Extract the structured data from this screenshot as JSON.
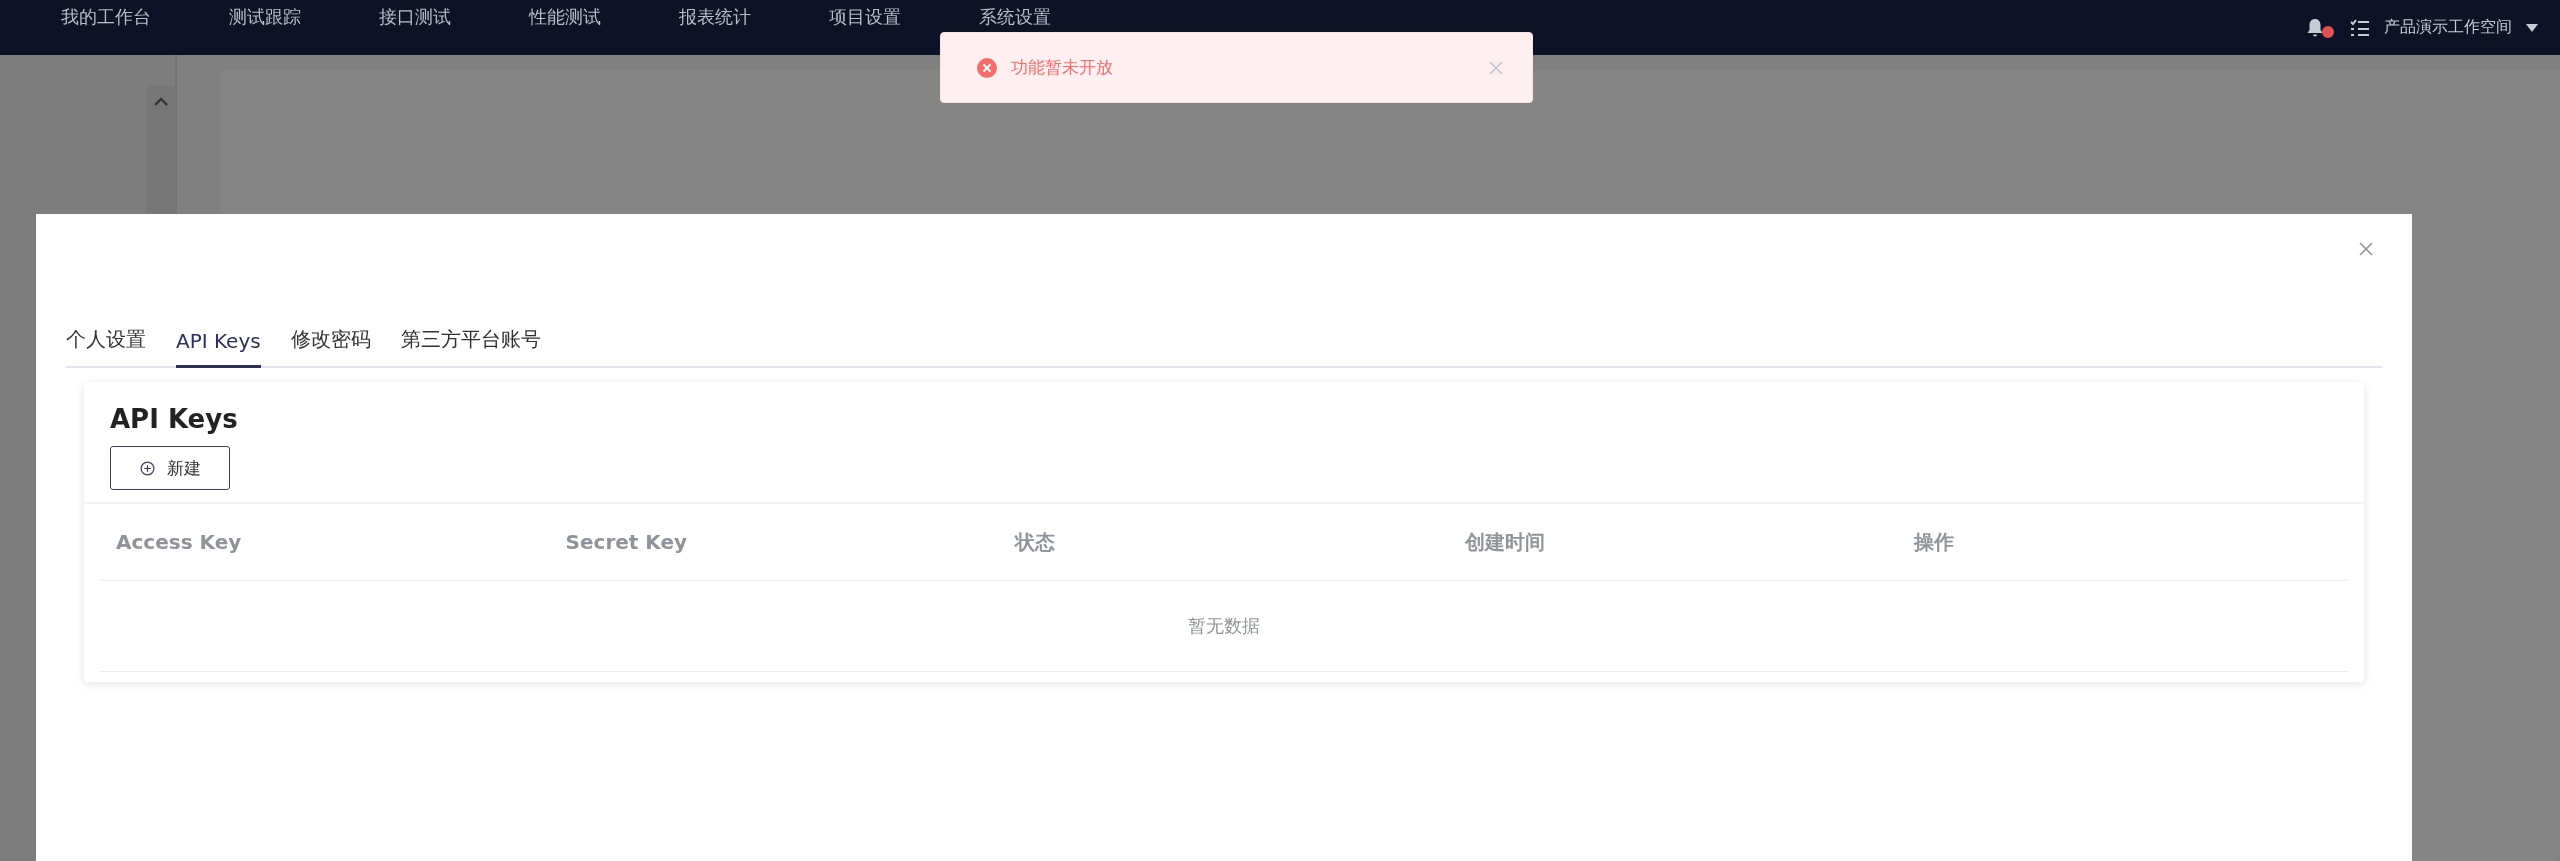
{
  "nav": {
    "items": [
      {
        "label": "我的工作台"
      },
      {
        "label": "测试跟踪"
      },
      {
        "label": "接口测试"
      },
      {
        "label": "性能测试"
      },
      {
        "label": "报表统计"
      },
      {
        "label": "项目设置"
      },
      {
        "label": "系统设置"
      }
    ],
    "workspace": "产品演示工作空间",
    "has_unread": true
  },
  "toast": {
    "kind": "error",
    "message": "功能暂未开放"
  },
  "dialog": {
    "tabs": [
      {
        "label": "个人设置",
        "selected": false
      },
      {
        "label": "API Keys",
        "selected": true
      },
      {
        "label": "修改密码",
        "selected": false
      },
      {
        "label": "第三方平台账号",
        "selected": false
      }
    ],
    "card": {
      "title": "API Keys",
      "new_button": "新建",
      "columns": [
        "Access Key",
        "Secret Key",
        "状态",
        "创建时间",
        "操作"
      ],
      "empty_text": "暂无数据"
    }
  }
}
